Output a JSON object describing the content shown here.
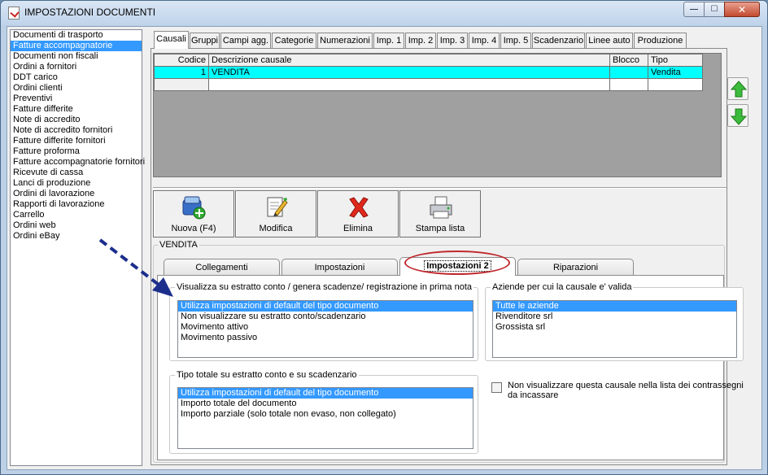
{
  "window": {
    "title": "IMPOSTAZIONI DOCUMENTI",
    "close_glyph": "✕"
  },
  "sidebar": {
    "items": [
      "Documenti di trasporto",
      "Fatture accompagnatorie",
      "Documenti non fiscali",
      "Ordini a fornitori",
      "DDT carico",
      "Ordini clienti",
      "Preventivi",
      "Fatture differite",
      "Note di accredito",
      "Note di accredito fornitori",
      "Fatture differite fornitori",
      "Fatture proforma",
      "Fatture accompagnatorie fornitori",
      "Ricevute di cassa",
      "Lanci di produzione",
      "Ordini di lavorazione",
      "Rapporti di lavorazione",
      "Carrello",
      "Ordini web",
      "Ordini eBay"
    ],
    "selected_index": 1
  },
  "main_tabs": [
    "Causali",
    "Gruppi",
    "Campi agg.",
    "Categorie",
    "Numerazioni",
    "Imp. 1",
    "Imp. 2",
    "Imp. 3",
    "Imp. 4",
    "Imp. 5",
    "Scadenzario",
    "Linee auto",
    "Produzione"
  ],
  "grid": {
    "headers": [
      "Codice",
      "Descrizione causale",
      "Blocco",
      "Tipo"
    ],
    "rows": [
      [
        "1",
        "VENDITA",
        "",
        "Vendita"
      ]
    ]
  },
  "toolbar": {
    "new_label": "Nuova (F4)",
    "edit_label": "Modifica",
    "delete_label": "Elimina",
    "print_label": "Stampa lista"
  },
  "detail": {
    "group_title": "VENDITA",
    "subtabs": [
      "Collegamenti",
      "Impostazioni",
      "Impostazioni 2",
      "Riparazioni"
    ],
    "statement_group": {
      "title": "Visualizza su estratto conto / genera scadenze/ registrazione  in prima nota",
      "options": [
        "Utilizza impostazioni di default del tipo documento",
        "Non visualizzare su estratto conto/scadenzario",
        "Movimento attivo",
        "Movimento passivo"
      ]
    },
    "companies_group": {
      "title": "Aziende per cui la causale e' valida",
      "options": [
        "Tutte le aziende",
        "Rivenditore srl",
        "Grossista srl"
      ]
    },
    "total_group": {
      "title": "Tipo totale su estratto conto e su scadenzario",
      "options": [
        "Utilizza impostazioni di default del tipo documento",
        "Importo totale del documento",
        "Importo parziale (solo totale non evaso, non collegato)"
      ]
    },
    "checkbox": {
      "line1": "Non visualizzare questa causale nella lista dei contrassegni",
      "line2": "da incassare"
    }
  },
  "colors": {
    "selection": "#3399ff",
    "grid_row_highlight": "#00ffff",
    "annotation": "#c0282d",
    "arrow": "#1c2e8c"
  }
}
